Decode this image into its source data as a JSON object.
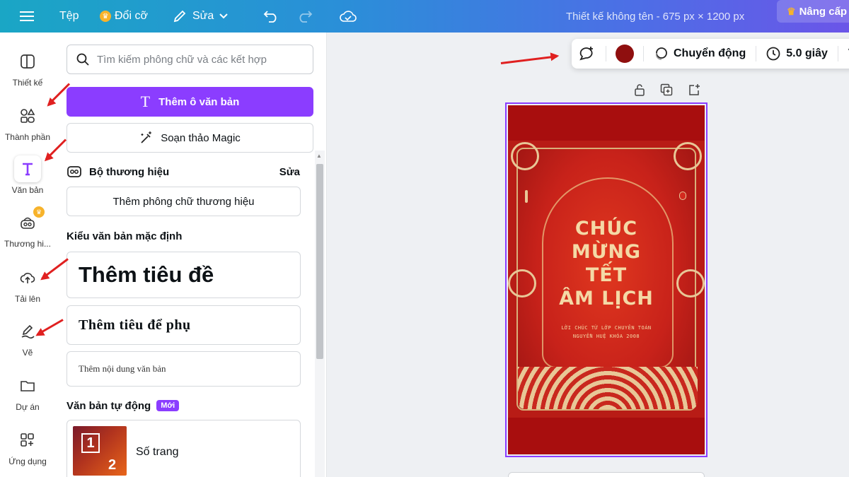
{
  "topbar": {
    "menu_icon": "hamburger-icon",
    "file": "Tệp",
    "resize": "Đổi cỡ",
    "edit": "Sửa",
    "doc_title": "Thiết kế không tên - 675 px × 1200 px",
    "upgrade": "Nâng cấp"
  },
  "rail": {
    "items": [
      {
        "label": "Thiết kế",
        "icon": "design-icon"
      },
      {
        "label": "Thành phần",
        "icon": "elements-icon"
      },
      {
        "label": "Văn bản",
        "icon": "text-icon"
      },
      {
        "label": "Thương hi...",
        "icon": "brand-icon"
      },
      {
        "label": "Tải lên",
        "icon": "upload-icon"
      },
      {
        "label": "Vẽ",
        "icon": "draw-icon"
      },
      {
        "label": "Dự án",
        "icon": "folder-icon"
      },
      {
        "label": "Ứng dụng",
        "icon": "apps-icon"
      }
    ]
  },
  "panel": {
    "search_placeholder": "Tìm kiếm phông chữ và các kết hợp",
    "add_textbox": "Thêm ô văn bản",
    "magic_write": "Soạn thảo Magic",
    "brand_kit": "Bộ thương hiệu",
    "brand_edit": "Sửa",
    "add_brand_font": "Thêm phông chữ thương hiệu",
    "default_styles": "Kiểu văn bản mặc định",
    "add_heading": "Thêm tiêu đề",
    "add_subheading": "Thêm tiêu để phụ",
    "add_body": "Thêm nội dung văn bản",
    "auto_text": "Văn bản tự động",
    "new_badge": "Mới",
    "page_numbers": "Số trang",
    "thumb_1": "1",
    "thumb_2": "2"
  },
  "toolbar": {
    "color": "#8f0f0f",
    "animate": "Chuyển động",
    "duration": "5.0 giây",
    "more": "V"
  },
  "design": {
    "title_lines": [
      "CHÚC",
      "MỪNG",
      "TẾT",
      "ÂM LỊCH"
    ],
    "sub_lines": [
      "LỜI CHÚC TỪ LỚP CHUYÊN TOÁN",
      "NGUYỄN HUỆ KHÓA 2008"
    ]
  },
  "colors": {
    "accent": "#8b3dff",
    "annotation_arrow": "#e02020"
  }
}
